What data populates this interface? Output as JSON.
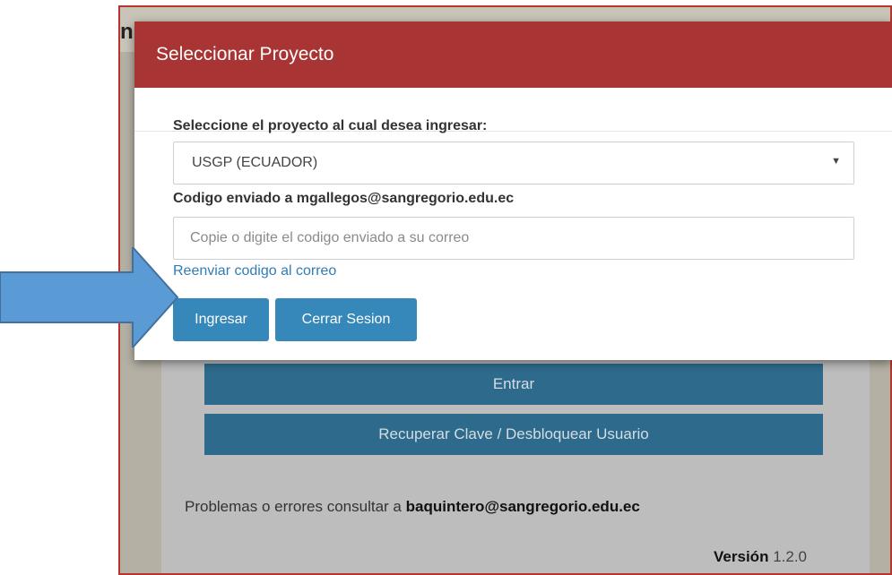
{
  "background": {
    "header_text": "n    ción",
    "enter_button": "Entrar",
    "recover_button": "Recuperar Clave / Desbloquear Usuario",
    "problems_text": "Problemas o errores consultar a ",
    "problems_email": "baquintero@sangregorio.edu.ec",
    "version_label": "Versión",
    "version_value": "1.2.0"
  },
  "modal": {
    "title": "Seleccionar Proyecto",
    "project_label": "Seleccione el proyecto al cual desea ingresar:",
    "project_selected": "USGP (ECUADOR)",
    "code_label": "Codigo enviado a mgallegos@sangregorio.edu.ec",
    "code_value": "",
    "code_placeholder": "Copie o digite el codigo enviado a su correo",
    "resend_link": "Reenviar codigo al correo",
    "login_button": "Ingresar",
    "logout_button": "Cerrar Sesion"
  },
  "annotation": {
    "arrow_color": "#5b9bd5",
    "arrow_icon": "arrow-right-icon"
  },
  "colors": {
    "modal_header": "#a83434",
    "primary_button": "#3687ba",
    "background_button": "#2e6a8c",
    "link": "#2e7db8"
  }
}
